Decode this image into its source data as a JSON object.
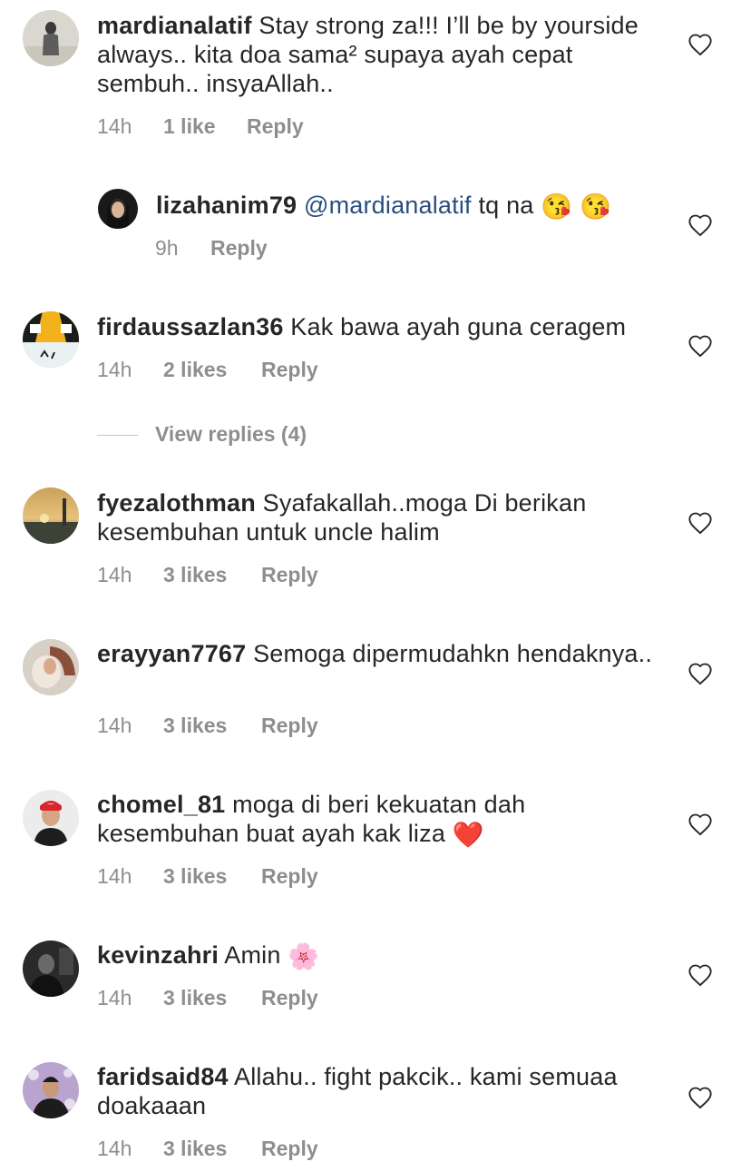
{
  "comments": [
    {
      "username": "mardianalatif",
      "text": "Stay strong za!!! I’ll be by yourside always.. kita doa sama² supaya ayah cepat sembuh.. insyaAllah..",
      "time": "14h",
      "likes": "1 like",
      "reply": "Reply"
    },
    {
      "username": "lizahanim79",
      "mention": "@mardianalatif",
      "text": "tq na",
      "emoji": "😘 😘",
      "time": "9h",
      "reply": "Reply"
    },
    {
      "username": "firdaussazlan36",
      "text": "Kak bawa ayah guna ceragem",
      "time": "14h",
      "likes": "2 likes",
      "reply": "Reply"
    },
    {
      "username": "fyezalothman",
      "text": "Syafakallah..moga Di berikan kesembuhan untuk uncle halim",
      "time": "14h",
      "likes": "3 likes",
      "reply": "Reply"
    },
    {
      "username": "erayyan7767",
      "text": "Semoga  dipermudahkn hendaknya..",
      "time": "14h",
      "likes": "3 likes",
      "reply": "Reply"
    },
    {
      "username": "chomel_81",
      "text": "moga di beri kekuatan dah kesembuhan  buat ayah kak liza",
      "emoji": "❤️",
      "time": "14h",
      "likes": "3 likes",
      "reply": "Reply"
    },
    {
      "username": "kevinzahri",
      "text": "Amin",
      "emoji": "🌸",
      "time": "14h",
      "likes": "3 likes",
      "reply": "Reply"
    },
    {
      "username": "faridsaid84",
      "text": "Allahu.. fight pakcik.. kami semuaa doakaaan",
      "time": "14h",
      "likes": "3 likes",
      "reply": "Reply"
    }
  ],
  "view_replies_label": "View replies (4)",
  "icons": {
    "like": "heart-outline-icon"
  },
  "colors": {
    "text": "#262626",
    "meta": "#8e8e8e",
    "mention": "#2b4d80",
    "heart_stroke": "#262626"
  }
}
